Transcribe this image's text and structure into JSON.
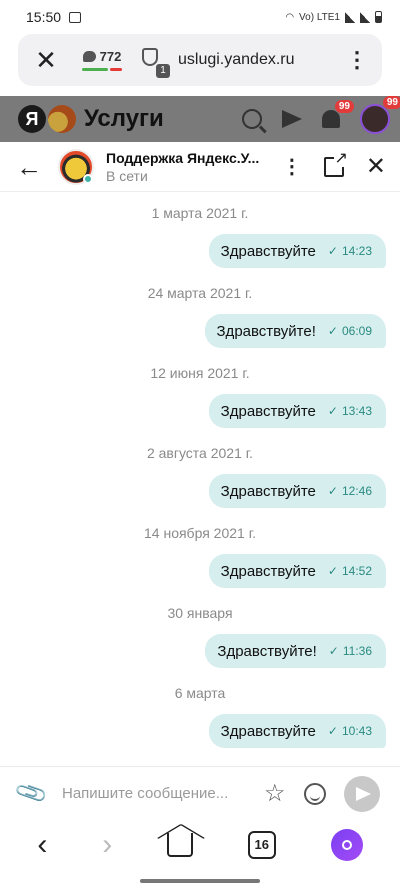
{
  "status_bar": {
    "time": "15:50",
    "network": "Vo) LTE1"
  },
  "url_bar": {
    "message_count": "772",
    "tabs_badge": "1",
    "url": "uslugi.yandex.ru",
    "score_colors": [
      "#4caf50",
      "#e53935"
    ]
  },
  "site_header": {
    "logo_letter": "Я",
    "title": "Услуги",
    "bell_badge": "99",
    "avatar_badge": "99"
  },
  "chat_header": {
    "name": "Поддержка Яндекс.У...",
    "status": "В сети"
  },
  "messages": [
    {
      "date": "1 марта 2021 г.",
      "text": "Здравствуйте",
      "time": "14:23"
    },
    {
      "date": "24 марта 2021 г.",
      "text": "Здравствуйте!",
      "time": "06:09"
    },
    {
      "date": "12 июня 2021 г.",
      "text": "Здравствуйте",
      "time": "13:43"
    },
    {
      "date": "2 августа 2021 г.",
      "text": "Здравствуйте",
      "time": "12:46"
    },
    {
      "date": "14 ноября 2021 г.",
      "text": "Здравствуйте",
      "time": "14:52"
    },
    {
      "date": "30 января",
      "text": "Здравствуйте!",
      "time": "11:36"
    },
    {
      "date": "6 марта",
      "text": "Здравствуйте",
      "time": "10:43"
    }
  ],
  "composer": {
    "placeholder": "Напишите сообщение..."
  },
  "browser_nav": {
    "tabs_count": "16"
  },
  "colors": {
    "bubble": "#d6eeee",
    "time_accent": "#2a8a80",
    "alice": "#7b3ff2",
    "badge": "#e23b3b"
  }
}
